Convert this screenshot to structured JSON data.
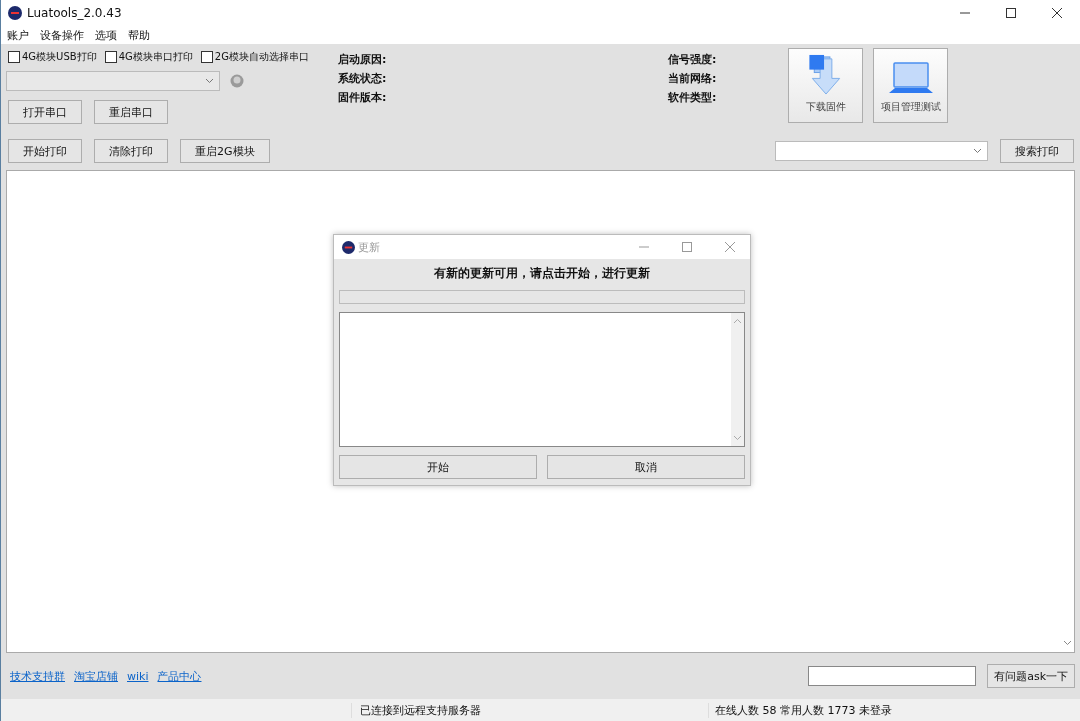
{
  "window": {
    "title": "Luatools_2.0.43"
  },
  "menu": [
    "账户",
    "设备操作",
    "选项",
    "帮助"
  ],
  "checkboxes": [
    {
      "label": "4G模块USB打印",
      "checked": false
    },
    {
      "label": "4G模块串口打印",
      "checked": false
    },
    {
      "label": "2G模块自动选择串口",
      "checked": false
    }
  ],
  "port_buttons": [
    "打开串口",
    "重启串口"
  ],
  "print_buttons": [
    "开始打印",
    "清除打印",
    "重启2G模块"
  ],
  "info_left": [
    "启动原因:",
    "系统状态:",
    "固件版本:"
  ],
  "info_right": [
    "信号强度:",
    "当前网络:",
    "软件类型:"
  ],
  "big_buttons": [
    {
      "kind": "download",
      "label": "下载固件"
    },
    {
      "kind": "project",
      "label": "项目管理测试"
    }
  ],
  "search_button": "搜索打印",
  "links": [
    "技术支持群",
    "淘宝店铺",
    "wiki",
    "产品中心"
  ],
  "ask_button": "有问题ask一下",
  "status_bar": [
    "已连接到远程支持服务器",
    "在线人数 58 常用人数 1773 未登录"
  ],
  "dialog": {
    "title": "更新",
    "message": "有新的更新可用，请点击开始，进行更新",
    "progress": {
      "level": 0
    },
    "buttons": [
      "开始",
      "取消"
    ]
  }
}
